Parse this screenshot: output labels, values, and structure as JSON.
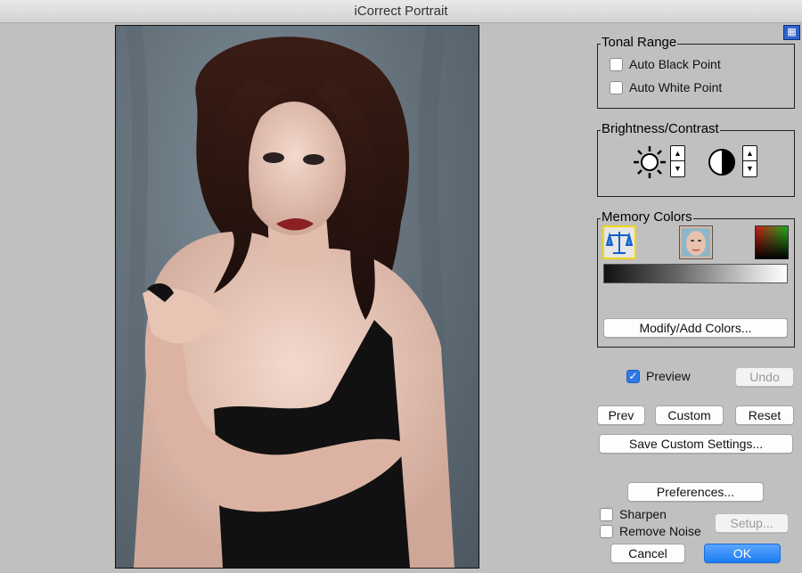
{
  "window": {
    "title": "iCorrect Portrait"
  },
  "help": {
    "icon": "help-grid-icon",
    "color": "#2c63c8"
  },
  "tonal_range": {
    "title": "Tonal Range",
    "auto_black": {
      "label": "Auto Black Point",
      "checked": false
    },
    "auto_white": {
      "label": "Auto White Point",
      "checked": false
    }
  },
  "brightness_contrast": {
    "title": "Brightness/Contrast",
    "brightness_icon": "sun-icon",
    "contrast_icon": "contrast-icon"
  },
  "memory_colors": {
    "title": "Memory Colors",
    "swatches": [
      {
        "icon": "neutral-balance-scale-icon",
        "selected": true
      },
      {
        "icon": "skin-tone-face-icon",
        "selected": false
      },
      {
        "icon": "color-gradient-icon",
        "selected": false
      }
    ],
    "modify_button": "Modify/Add Colors..."
  },
  "preview": {
    "label": "Preview",
    "checked": true
  },
  "buttons": {
    "undo": "Undo",
    "prev": "Prev",
    "custom": "Custom",
    "reset": "Reset",
    "save_custom": "Save Custom Settings...",
    "preferences": "Preferences...",
    "setup": "Setup...",
    "cancel": "Cancel",
    "ok": "OK"
  },
  "sharpen": {
    "label": "Sharpen",
    "checked": false
  },
  "remove_noise": {
    "label": "Remove Noise",
    "checked": false
  },
  "colors": {
    "accent": "#1d7cf2",
    "panel": "#c0c0c0"
  }
}
